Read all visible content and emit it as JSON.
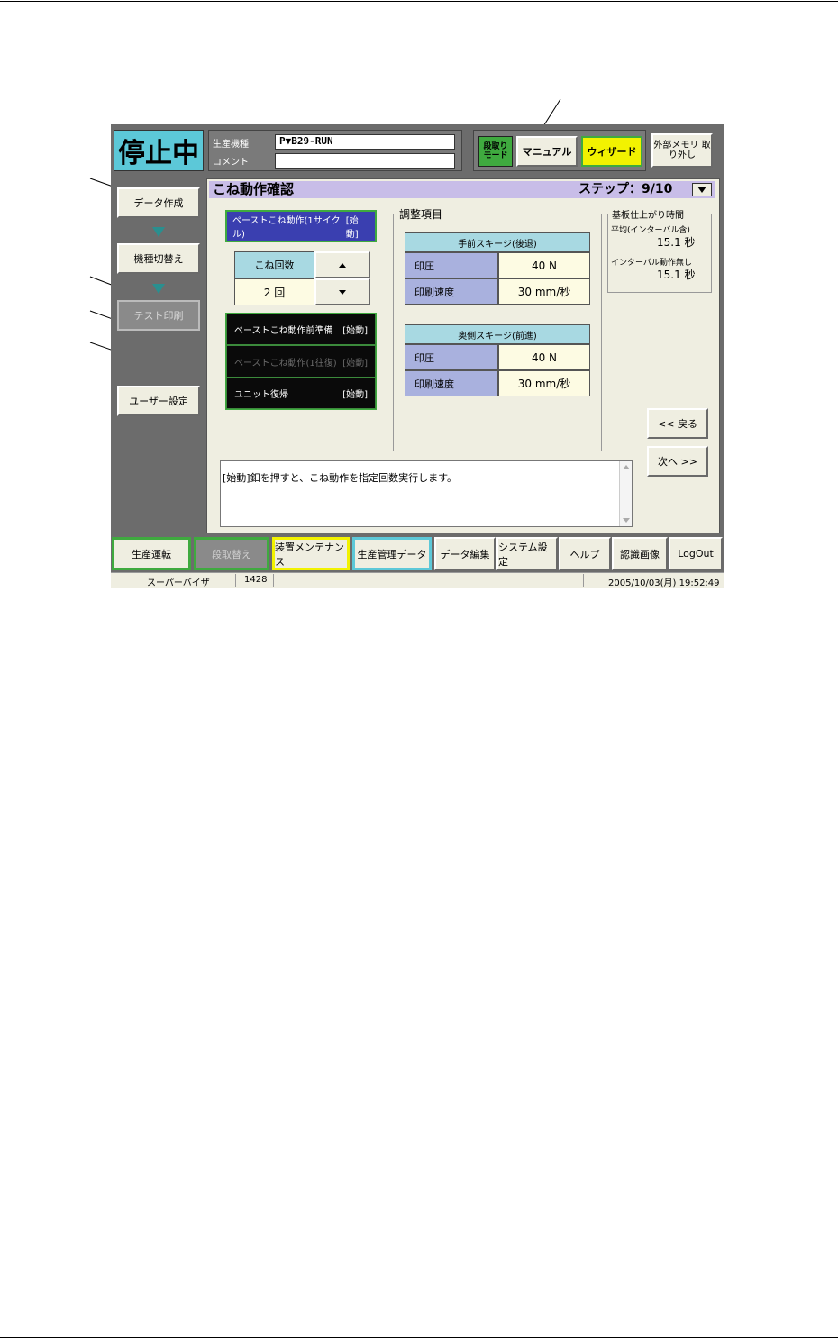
{
  "status": {
    "label": "停止中"
  },
  "header": {
    "model_label": "生産機種",
    "model_value": "P▼B29-RUN",
    "comment_label": "コメント",
    "comment_value": ""
  },
  "mode": {
    "setup_mode_label": "段取り モード",
    "manual_label": "マニュアル",
    "wizard_label": "ウィザード",
    "ext_memory_label": "外部メモリ 取り外し"
  },
  "sidebar": {
    "items": [
      {
        "label": "データ作成"
      },
      {
        "label": "機種切替え"
      },
      {
        "label": "テスト印刷"
      },
      {
        "label": "ユーザー設定"
      }
    ]
  },
  "page": {
    "title": "こね動作確認",
    "step": "ステップ：9/10"
  },
  "left_panel": {
    "paste_1cycle": "ペーストこね動作(1サイクル)",
    "start_tag": "[始動]",
    "count_label": "こね回数",
    "count_value": "2 回",
    "prep_label": "ペーストこね動作前準備",
    "roundtrip_label": "ペーストこね動作(1往復)",
    "unit_return_label": "ユニット復帰"
  },
  "adjust": {
    "group_title": "調整項目",
    "front": {
      "title": "手前スキージ(後退)",
      "pressure_label": "印圧",
      "pressure_value": "40 N",
      "speed_label": "印刷速度",
      "speed_value": "30 mm/秒"
    },
    "rear": {
      "title": "奥側スキージ(前進)",
      "pressure_label": "印圧",
      "pressure_value": "40 N",
      "speed_label": "印刷速度",
      "speed_value": "30 mm/秒"
    }
  },
  "finish_time": {
    "title": "基板仕上がり時間",
    "avg_label": "平均(インターバル含)",
    "avg_value": "15.1 秒",
    "nointerval_label": "インターバル動作無し",
    "nointerval_value": "15.1 秒"
  },
  "nav": {
    "back_label": "<< 戻る",
    "next_label": "次へ >>"
  },
  "message": {
    "text": "[始動]釦を押すと、こね動作を指定回数実行します。"
  },
  "bottom_tabs": [
    "生産運転",
    "段取替え",
    "装置メンテナンス",
    "生産管理データ",
    "データ編集",
    "システム設定",
    "ヘルプ",
    "認識画像",
    "LogOut"
  ],
  "statusbar": {
    "user": "スーパーバイザ",
    "code": "1428",
    "datetime": "2005/10/03(月) 19:52:49"
  },
  "colors": {
    "status_bg": "#5cc8d8",
    "title_bar": "#c8bde8",
    "blue_button": "#3a3fb0",
    "wizard_yellow": "#f2f200",
    "setup_green": "#3faa3f"
  }
}
